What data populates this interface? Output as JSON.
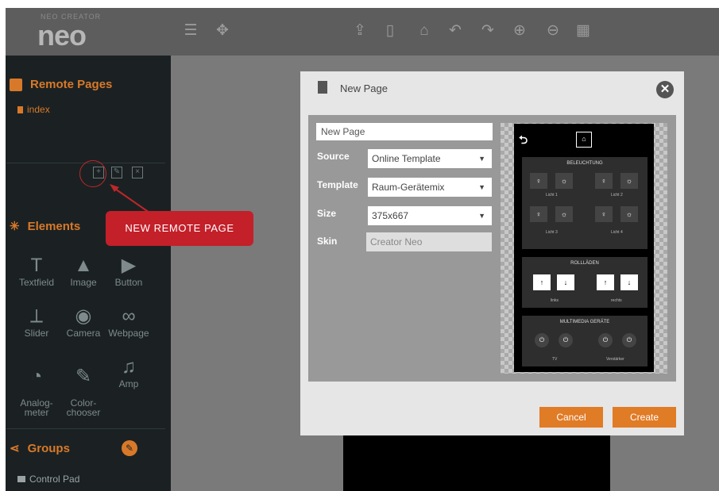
{
  "app": {
    "logo_small": "NEO CREATOR",
    "logo": "neo",
    "toolbar_icons": [
      "menu-icon",
      "puzzle-icon",
      "upload-icon",
      "phone-icon",
      "home-icon",
      "undo-icon",
      "redo-icon",
      "zoom-in-icon",
      "zoom-out-icon",
      "grid-icon"
    ]
  },
  "sidebar": {
    "remote_pages_title": "Remote Pages",
    "pages": [
      "index"
    ],
    "page_action_icons": [
      "new-page-icon",
      "edit-page-icon",
      "delete-page-icon"
    ],
    "elements_title": "Elements",
    "elements": [
      {
        "label": "Textfield",
        "icon": "textfield-icon",
        "glyph": "T"
      },
      {
        "label": "Image",
        "icon": "image-icon",
        "glyph": "▲"
      },
      {
        "label": "Button",
        "icon": "button-icon",
        "glyph": "▶"
      },
      {
        "label": "Slider",
        "icon": "slider-icon",
        "glyph": "⟂"
      },
      {
        "label": "Camera",
        "icon": "camera-icon",
        "glyph": "◉"
      },
      {
        "label": "Webpage",
        "icon": "link-icon",
        "glyph": "∞"
      },
      {
        "label": "Analog-\nmeter",
        "icon": "gauge-icon",
        "glyph": "◔"
      },
      {
        "label": "Color-\nchooser",
        "icon": "brush-icon",
        "glyph": "✎"
      },
      {
        "label": "Amp",
        "icon": "music-icon",
        "glyph": "♫"
      }
    ],
    "groups_title": "Groups",
    "groups": [
      "Control Pad"
    ]
  },
  "callout": {
    "text": "NEW REMOTE PAGE"
  },
  "dialog": {
    "title": "New Page",
    "name_value": "New Page",
    "source_label": "Source",
    "source_value": "Online Template",
    "template_label": "Template",
    "template_value": "Raum-Gerätemix",
    "size_label": "Size",
    "size_value": "375x667",
    "skin_label": "Skin",
    "skin_value": "Creator Neo",
    "cancel_label": "Cancel",
    "create_label": "Create"
  },
  "preview": {
    "section1": "BELEUCHTUNG",
    "lights": [
      "Licht 1",
      "Licht 2",
      "Licht 3",
      "Licht 4"
    ],
    "section2": "ROLLLÄDEN",
    "blinds": [
      "links",
      "rechts"
    ],
    "section3": "MULTIMEDIA GERÄTE",
    "media": [
      "TV",
      "Verstärker"
    ]
  },
  "colors": {
    "accent": "#e07b26",
    "callout": "#c3202a",
    "sidebar_bg": "#1b2122",
    "topbar_bg": "#5d5d5d"
  }
}
